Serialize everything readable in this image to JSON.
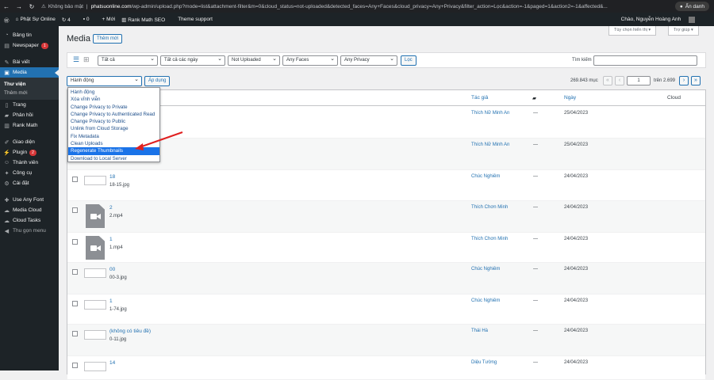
{
  "browser": {
    "security": "Không bảo mật",
    "host": "phatsuonline.com",
    "path": "/wp-admin/upload.php?mode=list&attachment-filter&m=0&cloud_status=not-uploaded&detected_faces=Any+Faces&cloud_privacy=Any+Privacy&filter_action=Lọc&action=-1&paged=1&action2=-1&affected&...",
    "incognito": "Ẩn danh"
  },
  "adminbar": {
    "site": "Phật Sự Online",
    "updates": "4",
    "comments": "0",
    "new": "+ Mới",
    "seo": "Rank Math SEO",
    "theme": "Theme support",
    "greeting": "Chào, Nguyễn Hoàng Anh"
  },
  "sidebar": {
    "items": [
      {
        "label": "Bảng tin",
        "icon": "dashboard-icon"
      },
      {
        "label": "Newspaper",
        "icon": "newspaper-icon",
        "badge": "1"
      },
      {
        "label": "Bài viết",
        "icon": "pin-icon"
      },
      {
        "label": "Media",
        "icon": "media-icon"
      }
    ],
    "sub": [
      "Thư viện",
      "Thêm mới"
    ],
    "items2": [
      {
        "label": "Trang",
        "icon": "page-icon"
      },
      {
        "label": "Phản hồi",
        "icon": "comment-icon"
      },
      {
        "label": "Rank Math",
        "icon": "chart-icon"
      },
      {
        "label": "Giao diện",
        "icon": "brush-icon"
      },
      {
        "label": "Plugin",
        "icon": "plugin-icon",
        "badge": "2"
      },
      {
        "label": "Thành viên",
        "icon": "user-icon"
      },
      {
        "label": "Công cụ",
        "icon": "wrench-icon"
      },
      {
        "label": "Cài đặt",
        "icon": "settings-icon"
      },
      {
        "label": "Use Any Font",
        "icon": "font-icon"
      },
      {
        "label": "Media Cloud",
        "icon": "cloud-icon"
      },
      {
        "label": "Cloud Tasks",
        "icon": "tasks-icon"
      },
      {
        "label": "Thu gọn menu",
        "icon": "collapse-icon"
      }
    ]
  },
  "page": {
    "title": "Media",
    "add_new": "Thêm mới",
    "screen_options": "Tùy chọn hiển thị ▾",
    "help": "Trợ giúp ▾"
  },
  "filters": {
    "type": "Tất cả",
    "dates": "Tất cả các ngày",
    "cloud_status": "Not Uploaded",
    "faces": "Any Faces",
    "privacy": "Any Privacy",
    "filter_button": "Lọc",
    "search_label": "Tìm kiếm"
  },
  "bulk": {
    "selected": "Hành động",
    "apply": "Áp dụng",
    "options": [
      "Hành động",
      "Xóa vĩnh viễn",
      "Change Privacy to Private",
      "Change Privacy to Authenticated Read",
      "Change Privacy to Public",
      "Unlink from Cloud Storage",
      "Fix Metadata",
      "Clean Uploads",
      "Regenerate Thumbnails",
      "Download to Local Server"
    ],
    "highlighted_index": 8
  },
  "pagination": {
    "count": "269.843 mục",
    "first": "«",
    "prev": "‹",
    "current": "1",
    "total": "trên 2.699",
    "next": "›",
    "last": "»"
  },
  "table": {
    "columns": {
      "author": "Tác giả",
      "date": "Ngày",
      "cloud": "Cloud"
    },
    "rows": [
      {
        "title": "",
        "file": "",
        "author": "Thích Nữ Minh An",
        "dash": "—",
        "date": "25/04/2023",
        "kind": "image"
      },
      {
        "title": "",
        "file": "",
        "author": "Thích Nữ Minh An",
        "dash": "—",
        "date": "25/04/2023",
        "kind": "image"
      },
      {
        "title": "18",
        "file": "18-15.jpg",
        "author": "Chúc Nghiêm",
        "dash": "—",
        "date": "24/04/2023",
        "kind": "image"
      },
      {
        "title": "2",
        "file": "2.mp4",
        "author": "Thích Chơn Minh",
        "dash": "—",
        "date": "24/04/2023",
        "kind": "video"
      },
      {
        "title": "1",
        "file": "1.mp4",
        "author": "Thích Chơn Minh",
        "dash": "—",
        "date": "24/04/2023",
        "kind": "video"
      },
      {
        "title": "00",
        "file": "00-3.jpg",
        "author": "Chúc Nghiêm",
        "dash": "—",
        "date": "24/04/2023",
        "kind": "image"
      },
      {
        "title": "1",
        "file": "1-74.jpg",
        "author": "Chúc Nghiêm",
        "dash": "—",
        "date": "24/04/2023",
        "kind": "image"
      },
      {
        "title": "(không có tiêu đề)",
        "file": "0-11.jpg",
        "author": "Thái Hà",
        "dash": "—",
        "date": "24/04/2023",
        "kind": "image"
      },
      {
        "title": "14",
        "file": "",
        "author": "Diệu Tường",
        "dash": "—",
        "date": "24/04/2023",
        "kind": "image"
      }
    ]
  },
  "colors": {
    "accent": "#2271b1",
    "sidebar": "#1d2327",
    "highlight": "#1a73e8",
    "arrow": "#e02020"
  }
}
